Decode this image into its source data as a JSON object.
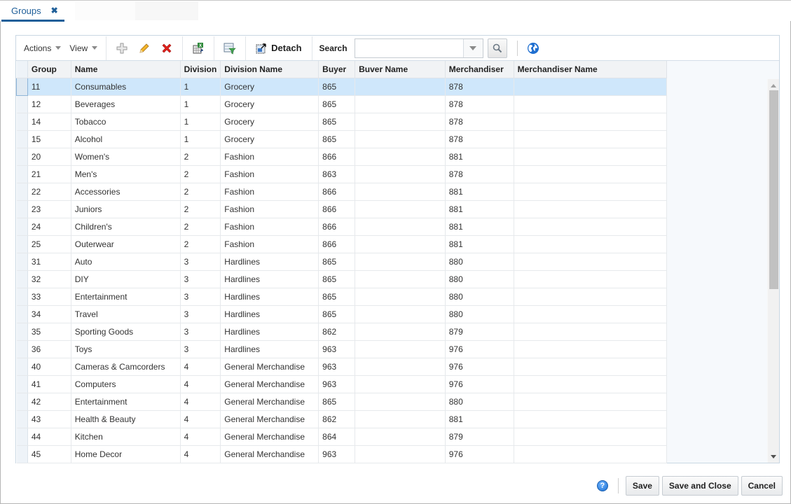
{
  "tab": {
    "label": "Groups",
    "close": "✖"
  },
  "toolbar": {
    "actions_label": "Actions",
    "view_label": "View",
    "detach_label": "Detach",
    "search_label": "Search",
    "search_value": "",
    "icons": [
      "add-icon",
      "edit-icon",
      "delete-icon",
      "export-excel-icon",
      "query-by-example-icon",
      "detach-icon",
      "search-icon",
      "globe-icon"
    ]
  },
  "table": {
    "columns": [
      "Group",
      "Name",
      "Division",
      "Division Name",
      "Buyer",
      "Buver Name",
      "Merchandiser",
      "Merchandiser Name"
    ],
    "selected_row": 0,
    "rows": [
      {
        "group": "11",
        "name": "Consumables",
        "division": "1",
        "division_name": "Grocery",
        "buyer": "865",
        "buyer_name": "",
        "merchandiser": "878",
        "merchandiser_name": ""
      },
      {
        "group": "12",
        "name": "Beverages",
        "division": "1",
        "division_name": "Grocery",
        "buyer": "865",
        "buyer_name": "",
        "merchandiser": "878",
        "merchandiser_name": ""
      },
      {
        "group": "14",
        "name": "Tobacco",
        "division": "1",
        "division_name": "Grocery",
        "buyer": "865",
        "buyer_name": "",
        "merchandiser": "878",
        "merchandiser_name": ""
      },
      {
        "group": "15",
        "name": "Alcohol",
        "division": "1",
        "division_name": "Grocery",
        "buyer": "865",
        "buyer_name": "",
        "merchandiser": "878",
        "merchandiser_name": ""
      },
      {
        "group": "20",
        "name": "Women's",
        "division": "2",
        "division_name": "Fashion",
        "buyer": "866",
        "buyer_name": "",
        "merchandiser": "881",
        "merchandiser_name": ""
      },
      {
        "group": "21",
        "name": "Men's",
        "division": "2",
        "division_name": "Fashion",
        "buyer": "863",
        "buyer_name": "",
        "merchandiser": "878",
        "merchandiser_name": ""
      },
      {
        "group": "22",
        "name": "Accessories",
        "division": "2",
        "division_name": "Fashion",
        "buyer": "866",
        "buyer_name": "",
        "merchandiser": "881",
        "merchandiser_name": ""
      },
      {
        "group": "23",
        "name": "Juniors",
        "division": "2",
        "division_name": "Fashion",
        "buyer": "866",
        "buyer_name": "",
        "merchandiser": "881",
        "merchandiser_name": ""
      },
      {
        "group": "24",
        "name": "Children's",
        "division": "2",
        "division_name": "Fashion",
        "buyer": "866",
        "buyer_name": "",
        "merchandiser": "881",
        "merchandiser_name": ""
      },
      {
        "group": "25",
        "name": "Outerwear",
        "division": "2",
        "division_name": "Fashion",
        "buyer": "866",
        "buyer_name": "",
        "merchandiser": "881",
        "merchandiser_name": ""
      },
      {
        "group": "31",
        "name": "Auto",
        "division": "3",
        "division_name": "Hardlines",
        "buyer": "865",
        "buyer_name": "",
        "merchandiser": "880",
        "merchandiser_name": ""
      },
      {
        "group": "32",
        "name": "DIY",
        "division": "3",
        "division_name": "Hardlines",
        "buyer": "865",
        "buyer_name": "",
        "merchandiser": "880",
        "merchandiser_name": ""
      },
      {
        "group": "33",
        "name": "Entertainment",
        "division": "3",
        "division_name": "Hardlines",
        "buyer": "865",
        "buyer_name": "",
        "merchandiser": "880",
        "merchandiser_name": ""
      },
      {
        "group": "34",
        "name": "Travel",
        "division": "3",
        "division_name": "Hardlines",
        "buyer": "865",
        "buyer_name": "",
        "merchandiser": "880",
        "merchandiser_name": ""
      },
      {
        "group": "35",
        "name": "Sporting Goods",
        "division": "3",
        "division_name": "Hardlines",
        "buyer": "862",
        "buyer_name": "",
        "merchandiser": "879",
        "merchandiser_name": ""
      },
      {
        "group": "36",
        "name": "Toys",
        "division": "3",
        "division_name": "Hardlines",
        "buyer": "963",
        "buyer_name": "",
        "merchandiser": "976",
        "merchandiser_name": ""
      },
      {
        "group": "40",
        "name": "Cameras & Camcorders",
        "division": "4",
        "division_name": "General Merchandise",
        "buyer": "963",
        "buyer_name": "",
        "merchandiser": "976",
        "merchandiser_name": ""
      },
      {
        "group": "41",
        "name": "Computers",
        "division": "4",
        "division_name": "General Merchandise",
        "buyer": "963",
        "buyer_name": "",
        "merchandiser": "976",
        "merchandiser_name": ""
      },
      {
        "group": "42",
        "name": "Entertainment",
        "division": "4",
        "division_name": "General Merchandise",
        "buyer": "865",
        "buyer_name": "",
        "merchandiser": "880",
        "merchandiser_name": ""
      },
      {
        "group": "43",
        "name": "Health & Beauty",
        "division": "4",
        "division_name": "General Merchandise",
        "buyer": "862",
        "buyer_name": "",
        "merchandiser": "881",
        "merchandiser_name": ""
      },
      {
        "group": "44",
        "name": "Kitchen",
        "division": "4",
        "division_name": "General Merchandise",
        "buyer": "864",
        "buyer_name": "",
        "merchandiser": "879",
        "merchandiser_name": ""
      },
      {
        "group": "45",
        "name": "Home Decor",
        "division": "4",
        "division_name": "General Merchandise",
        "buyer": "963",
        "buyer_name": "",
        "merchandiser": "976",
        "merchandiser_name": ""
      }
    ]
  },
  "footer": {
    "help_label": "?",
    "save_label": "Save",
    "save_close_label": "Save and Close",
    "cancel_label": "Cancel"
  },
  "colors": {
    "accent": "#1f5f99",
    "selected_row": "#cfe7fb",
    "delete_red": "#e0201b"
  }
}
